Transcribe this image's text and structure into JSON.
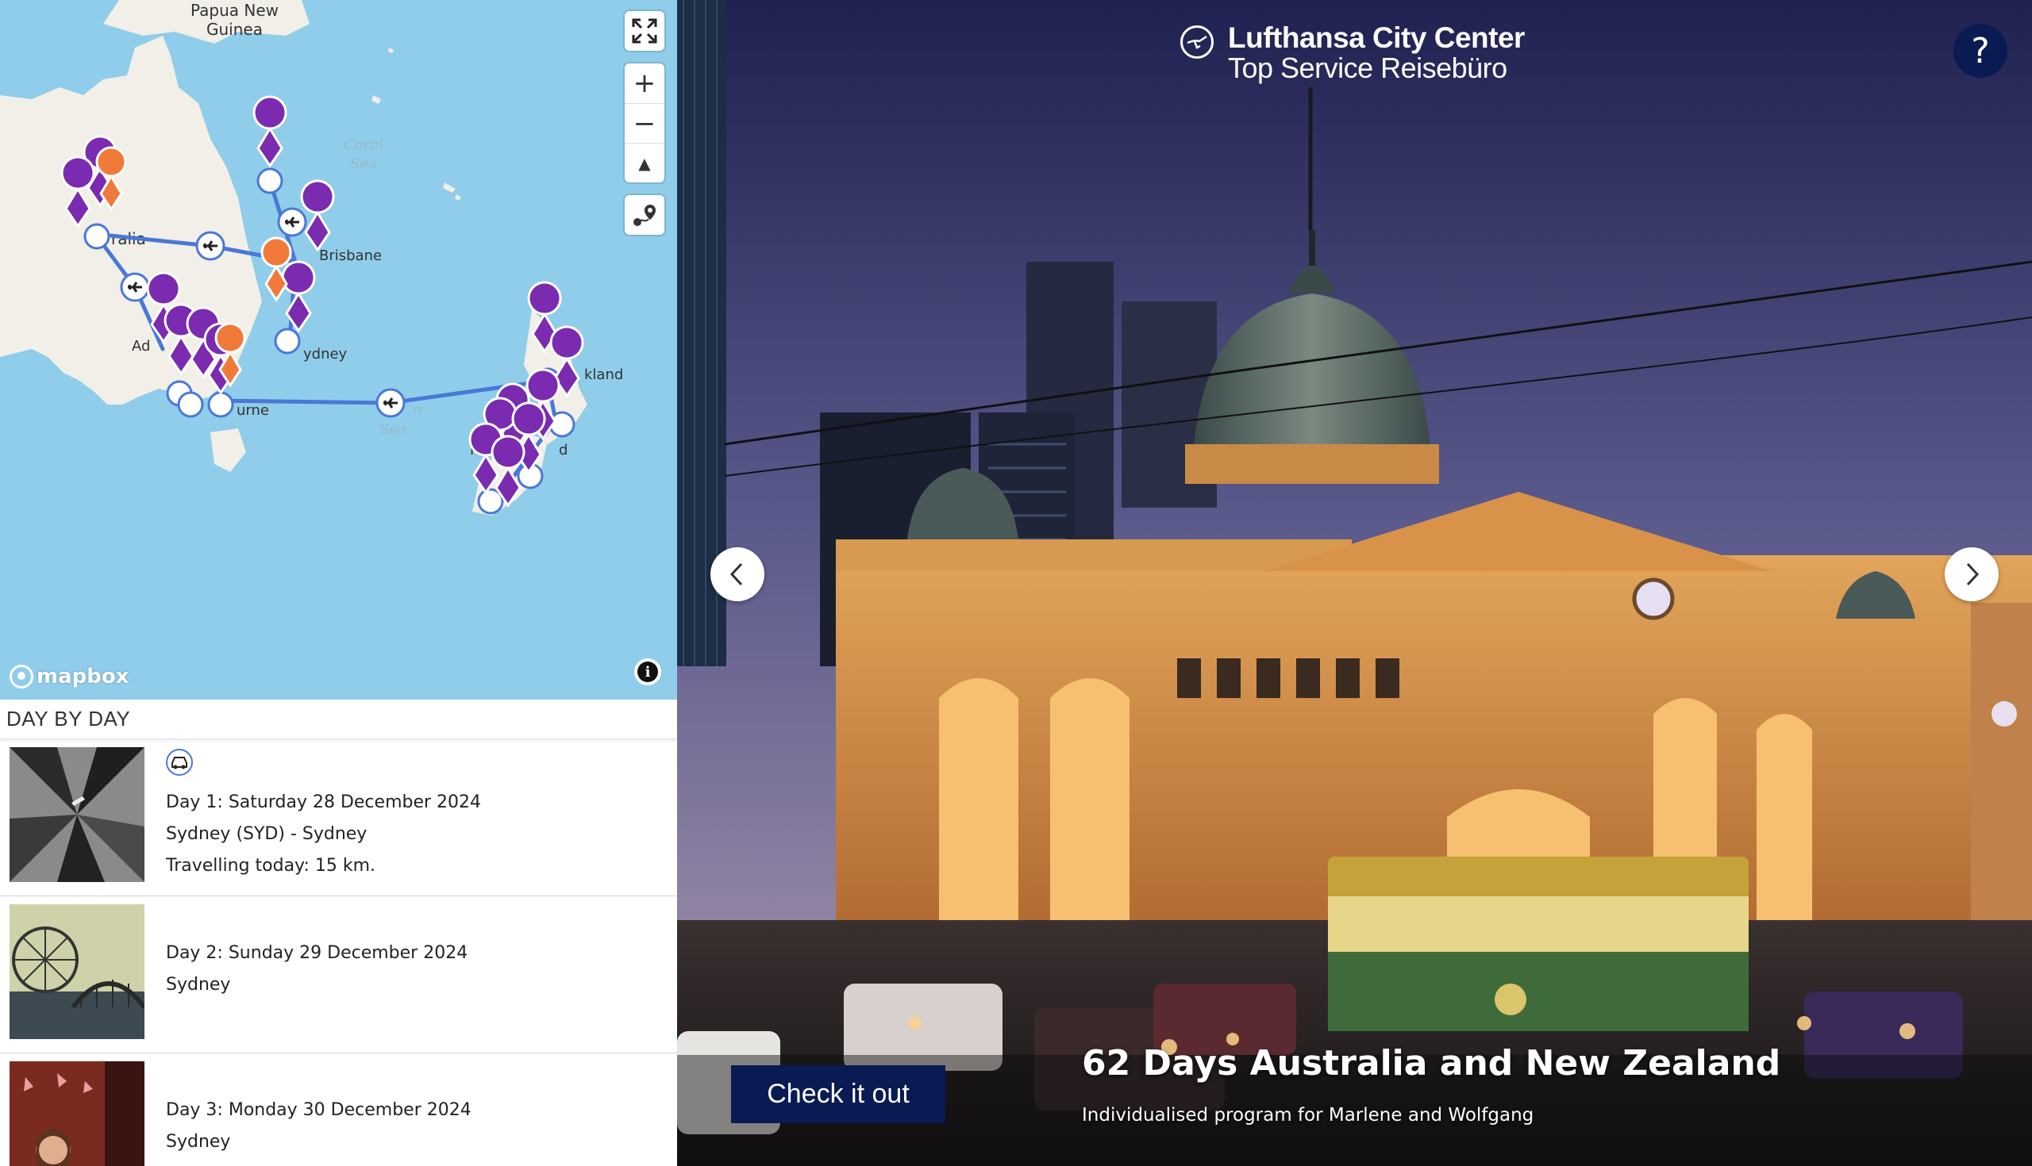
{
  "map": {
    "labels": {
      "papua": "Papua New",
      "guinea": "Guinea",
      "coral": "Coral",
      "sea": "Sea",
      "australia": "ralia",
      "brisbane": "Brisbane",
      "sydney": "ydney",
      "adelaide": "Ad",
      "melbourne": "urne",
      "tasman": "n",
      "tasman_sea": "Sea",
      "auckland": "kland",
      "nz_n": "N",
      "nz_d": "d"
    },
    "controls": {
      "fullscreen_icon": "fullscreen-icon",
      "zoom_in": "+",
      "zoom_out": "−",
      "compass": "▲",
      "route_icon": "route-icon"
    },
    "attribution": {
      "logo": "mapbox",
      "info": "i"
    },
    "colors": {
      "water": "#8fcdea",
      "land": "#f1efe7",
      "route": "#4a78d6",
      "hotel_pin": "#7a2bb0",
      "highlight_pin": "#f07a3a"
    }
  },
  "day_by_day": {
    "header": "DAY BY DAY",
    "days": [
      {
        "lines": [
          "Day 1: Saturday 28 December 2024",
          "Sydney (SYD) - Sydney",
          "Travelling today: 15 km."
        ],
        "transport_icon": "car-icon"
      },
      {
        "lines": [
          "Day 2: Sunday 29 December 2024",
          "Sydney"
        ]
      },
      {
        "lines": [
          "Day 3: Monday 30 December 2024",
          "Sydney"
        ]
      }
    ]
  },
  "hero": {
    "brand_name": "Lufthansa City Center",
    "brand_tagline": "Top Service Reisebüro",
    "help_label": "?",
    "cta_label": "Check it out",
    "title": "62 Days Australia and New Zealand",
    "subtitle": "Individualised program for Marlene and Wolfgang",
    "prev_icon": "chevron-left-icon",
    "next_icon": "chevron-right-icon"
  }
}
